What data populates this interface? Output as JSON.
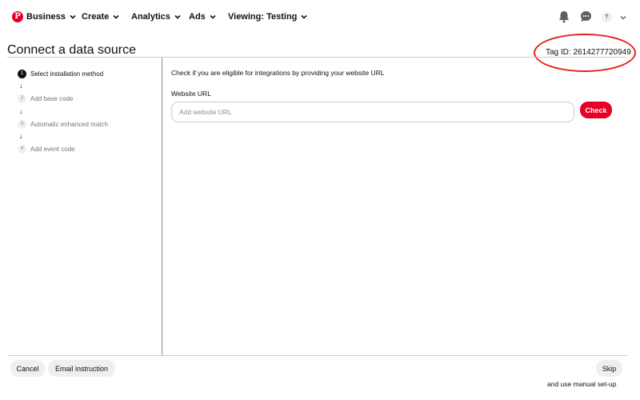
{
  "nav": {
    "items": [
      {
        "label": "Business"
      },
      {
        "label": "Create"
      },
      {
        "label": "Analytics"
      },
      {
        "label": "Ads"
      },
      {
        "label": "Viewing: Testing"
      }
    ],
    "avatar_initial": "T",
    "icons": [
      "pinterest-logo-icon",
      "bell-icon",
      "chat-icon",
      "chevron-down-icon"
    ],
    "brand_color": "#e60023"
  },
  "header": {
    "title": "Connect a data source",
    "tag_label": "Tag ID:",
    "tag_id": "2614277720949",
    "annotation_color": "#e8201b"
  },
  "steps": [
    {
      "number": "1",
      "label": "Select installation method",
      "active": true
    },
    {
      "number": "2",
      "label": "Add base code",
      "active": false
    },
    {
      "number": "3",
      "label": "Automatic enhanced match",
      "active": false
    },
    {
      "number": "4",
      "label": "Add event code",
      "active": false
    }
  ],
  "main": {
    "intro": "Check if you are eligible for integrations by providing your website URL",
    "field_label": "Website URL",
    "url_value": "",
    "url_placeholder": "Add website URL",
    "check_label": "Check"
  },
  "footer": {
    "cancel_label": "Cancel",
    "email_label": "Email instruction",
    "skip_label": "Skip",
    "manual_note": "and use manual set-up"
  }
}
